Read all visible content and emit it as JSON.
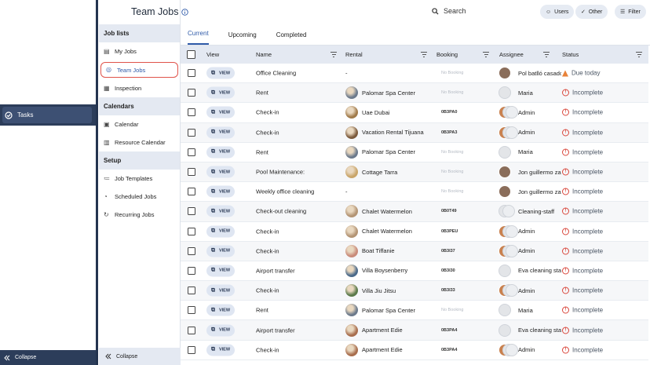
{
  "nav": {
    "tasks_label": "Tasks",
    "collapse_label": "Collapse"
  },
  "sidebar": {
    "job_lists_heading": "Job lists",
    "my_jobs": "My Jobs",
    "team_jobs": "Team Jobs",
    "inspection": "Inspection",
    "calendars_heading": "Calendars",
    "calendar": "Calendar",
    "resource_calendar": "Resource Calendar",
    "setup_heading": "Setup",
    "job_templates": "Job Templates",
    "scheduled_jobs": "Scheduled Jobs",
    "recurring_jobs": "Recurring Jobs",
    "collapse_label": "Collapse"
  },
  "header": {
    "title": "Team Jobs",
    "search_placeholder": "Search",
    "users_label": "Users",
    "other_label": "Other",
    "filter_label": "Filter"
  },
  "tabs": [
    "Current",
    "Upcoming",
    "Completed"
  ],
  "table": {
    "columns": {
      "view": "View",
      "name": "Name",
      "rental": "Rental",
      "booking": "Booking",
      "assignee": "Assignee",
      "status": "Status"
    },
    "view_label": "VIEW",
    "rows": [
      {
        "name": "Office Cleaning",
        "rental": "-",
        "rental_color": "",
        "booking": "No Booking",
        "assignee": "Pol batlló casado",
        "av": "single",
        "status": "Due today",
        "status_type": "warn"
      },
      {
        "name": "Rent",
        "rental": "Palomar Spa Center",
        "rental_color": "#6c7a8c",
        "booking": "No Booking",
        "assignee": "Maria",
        "av": "blank",
        "status": "Incomplete",
        "status_type": "alert"
      },
      {
        "name": "Check-in",
        "rental": "Uae Dubai",
        "rental_color": "#a07a4a",
        "booking": "0B3PA0",
        "assignee": "Admin",
        "av": "group",
        "status": "Incomplete",
        "status_type": "alert"
      },
      {
        "name": "Check-in",
        "rental": "Vacation Rental Tijuana",
        "rental_color": "#7b5a3c",
        "booking": "0B3PA3",
        "assignee": "Admin",
        "av": "group",
        "status": "Incomplete",
        "status_type": "alert"
      },
      {
        "name": "Rent",
        "rental": "Palomar Spa Center",
        "rental_color": "#6c7a8c",
        "booking": "No Booking",
        "assignee": "Maria",
        "av": "blank",
        "status": "Incomplete",
        "status_type": "alert"
      },
      {
        "name": "Pool Maintenance:",
        "rental": "Cottage Tarra",
        "rental_color": "#c9a56a",
        "booking": "No Booking",
        "assignee": "Jon guillermo zapata",
        "av": "single",
        "status": "Incomplete",
        "status_type": "alert"
      },
      {
        "name": "Weekly office cleaning",
        "rental": "-",
        "rental_color": "",
        "booking": "No Booking",
        "assignee": "Jon guillermo zapata",
        "av": "single",
        "status": "Incomplete",
        "status_type": "alert"
      },
      {
        "name": "Check-out cleaning",
        "rental": "Chalet Watermelon",
        "rental_color": "#b39474",
        "booking": "0B0T49",
        "assignee": "Cleaning-staff",
        "av": "pair",
        "status": "Incomplete",
        "status_type": "alert"
      },
      {
        "name": "Check-in",
        "rental": "Chalet Watermelon",
        "rental_color": "#b39474",
        "booking": "0B3PEU",
        "assignee": "Admin",
        "av": "group",
        "status": "Incomplete",
        "status_type": "alert"
      },
      {
        "name": "Check-in",
        "rental": "Boat Tiffanie",
        "rental_color": "#c98b7a",
        "booking": "0B3I37",
        "assignee": "Admin",
        "av": "group",
        "status": "Incomplete",
        "status_type": "alert"
      },
      {
        "name": "Airport transfer",
        "rental": "Villa Boysenberry",
        "rental_color": "#4b6a8a",
        "booking": "0B3I30",
        "assignee": "Eva cleaning staff",
        "av": "blank",
        "status": "Incomplete",
        "status_type": "alert"
      },
      {
        "name": "Check-in",
        "rental": "Villa Jiu Jitsu",
        "rental_color": "#5b7a4a",
        "booking": "0B3I33",
        "assignee": "Admin",
        "av": "group",
        "status": "Incomplete",
        "status_type": "alert"
      },
      {
        "name": "Rent",
        "rental": "Palomar Spa Center",
        "rental_color": "#6c7a8c",
        "booking": "No Booking",
        "assignee": "Maria",
        "av": "blank",
        "status": "Incomplete",
        "status_type": "alert"
      },
      {
        "name": "Airport transfer",
        "rental": "Apartment Edie",
        "rental_color": "#a86e4e",
        "booking": "0B3PA4",
        "assignee": "Eva cleaning staff",
        "av": "blank",
        "status": "Incomplete",
        "status_type": "alert"
      },
      {
        "name": "Check-in",
        "rental": "Apartment Edie",
        "rental_color": "#a86e4e",
        "booking": "0B3PA4",
        "assignee": "Admin",
        "av": "group",
        "status": "Incomplete",
        "status_type": "alert"
      }
    ]
  }
}
